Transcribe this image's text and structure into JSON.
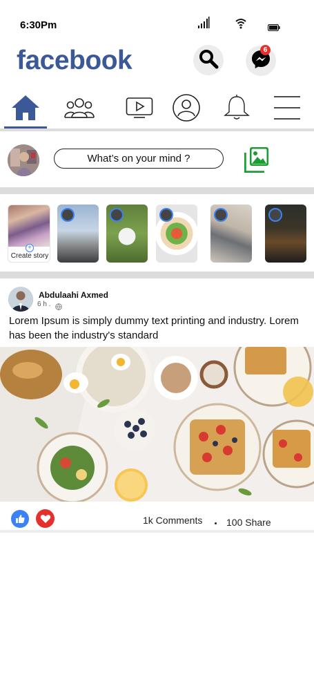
{
  "status_bar": {
    "time": "6:30Pm",
    "icons": [
      "signal-icon",
      "wifi-icon",
      "battery-icon"
    ]
  },
  "header": {
    "brand": "facebook",
    "brand_color": "#3b5998",
    "search_icon": "search-icon",
    "messenger_icon": "messenger-icon",
    "messenger_badge": "6"
  },
  "nav": {
    "tabs": [
      {
        "name": "home",
        "icon": "home-icon",
        "active": true
      },
      {
        "name": "friends",
        "icon": "friends-icon"
      },
      {
        "name": "watch",
        "icon": "video-icon"
      },
      {
        "name": "profile",
        "icon": "profile-icon"
      },
      {
        "name": "notifications",
        "icon": "bell-icon"
      },
      {
        "name": "menu",
        "icon": "hamburger-icon"
      }
    ]
  },
  "composer": {
    "prompt": "What’s on your mind ?",
    "photo_icon": "photo-icon",
    "photo_icon_color": "#1a9e33"
  },
  "stories": {
    "create_label": "Create story",
    "items": 5
  },
  "post": {
    "author": "Abdulaahi Axmed",
    "time": "6 h .",
    "text": "Lorem Ipsum is simply dummy text  printing and industry. Lorem  has been the industry's standard",
    "comments": "1k Comments",
    "shares": "100 Share",
    "like_color": "#3b82f6",
    "love_color": "#e4312d"
  }
}
